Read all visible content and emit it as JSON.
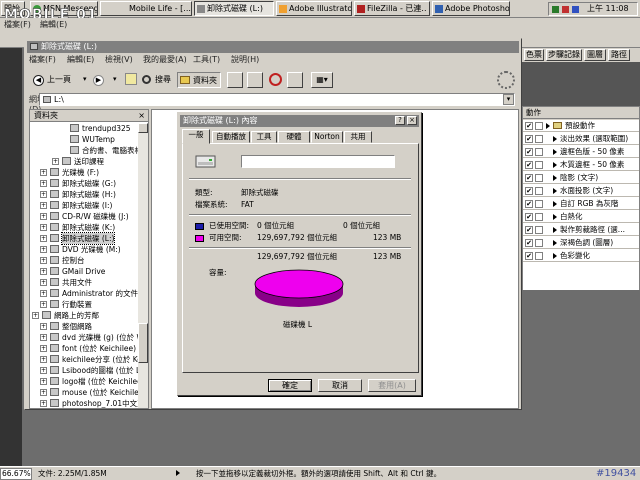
{
  "taskbar": {
    "start_label": "開始",
    "tasks": [
      {
        "label": "MSN Messenger (...",
        "active": false
      },
      {
        "label": "Mobile Life - [...",
        "active": false
      },
      {
        "label": "卸除式磁碟 (L:)",
        "active": true
      },
      {
        "label": "Adobe Illustrator -...",
        "active": false
      },
      {
        "label": "FileZilla - 已連..",
        "active": false
      },
      {
        "label": "Adobe Photoshop",
        "active": false
      }
    ],
    "clock": "上午 11:08"
  },
  "logo_text": "MOBILE 01",
  "ps_menu": [
    "檔案(F)",
    "編輯(E)"
  ],
  "explorer": {
    "title": "卸除式磁碟 (L:)",
    "menu": [
      "檔案(F)",
      "編輯(E)",
      "檢視(V)",
      "我的最愛(A)",
      "工具(T)",
      "說明(H)"
    ],
    "toolbar": {
      "back": "上一頁",
      "search": "搜尋",
      "folders": "資料夾"
    },
    "address_label": "網址(D)",
    "address_value": "L:\\",
    "folders_header": "資料夾",
    "tree": [
      {
        "label": "trendupd325",
        "indent": 30,
        "plus": false
      },
      {
        "label": "WUTemp",
        "indent": 30,
        "plus": false
      },
      {
        "label": "合約書、電腦表格",
        "indent": 30,
        "plus": false
      },
      {
        "label": "送印課程",
        "indent": 22,
        "plus": true
      },
      {
        "label": "光碟機 (F:)",
        "indent": 10,
        "plus": true
      },
      {
        "label": "卸除式磁碟 (G:)",
        "indent": 10,
        "plus": true
      },
      {
        "label": "卸除式磁碟 (H:)",
        "indent": 10,
        "plus": true
      },
      {
        "label": "卸除式磁碟 (I:)",
        "indent": 10,
        "plus": true
      },
      {
        "label": "CD-R/W 磁碟機 (J:)",
        "indent": 10,
        "plus": true
      },
      {
        "label": "卸除式磁碟 (K:)",
        "indent": 10,
        "plus": true
      },
      {
        "label": "卸除式磁碟 (L:)",
        "indent": 10,
        "plus": true,
        "selected": true
      },
      {
        "label": "DVD 光碟機 (M:)",
        "indent": 10,
        "plus": true
      },
      {
        "label": "控制台",
        "indent": 10,
        "plus": true
      },
      {
        "label": "GMail Drive",
        "indent": 10,
        "plus": true
      },
      {
        "label": "共用文件",
        "indent": 10,
        "plus": true
      },
      {
        "label": "Administrator 的文件",
        "indent": 10,
        "plus": true
      },
      {
        "label": "行動裝置",
        "indent": 10,
        "plus": true
      },
      {
        "label": "網路上的芳鄰",
        "indent": 2,
        "plus": true
      },
      {
        "label": "整個網路",
        "indent": 10,
        "plus": true
      },
      {
        "label": "dvd 光碟機 (g) (位於 W",
        "indent": 10,
        "plus": true
      },
      {
        "label": "font (位於 Keichilee)",
        "indent": 10,
        "plus": true
      },
      {
        "label": "keichilee分享 (位於 Kei",
        "indent": 10,
        "plus": true
      },
      {
        "label": "Lsibood的圖檔 (位於 L:",
        "indent": 10,
        "plus": true
      },
      {
        "label": "logo檔 (位於 Keichilee)",
        "indent": 10,
        "plus": true
      },
      {
        "label": "mouse (位於 Keichilee)",
        "indent": 10,
        "plus": true
      },
      {
        "label": "photoshop_7.01中文正式",
        "indent": 10,
        "plus": true
      }
    ]
  },
  "dialog": {
    "title": "卸除式磁碟 (L:) 內容",
    "help": "?",
    "close": "×",
    "tabs": [
      "一般",
      "自動播放",
      "工具",
      "硬體",
      "Norton",
      "共用"
    ],
    "type_label": "類型:",
    "type_value": "卸除式磁碟",
    "fs_label": "檔案系統:",
    "fs_value": "FAT",
    "used_label": "已使用空間:",
    "used_bytes": "0 個位元組",
    "used_size": "0 個位元組",
    "free_label": "可用空間:",
    "free_bytes": "129,697,792 個位元組",
    "free_size": "123 MB",
    "capacity_label": "容量:",
    "capacity_bytes": "129,697,792 個位元組",
    "capacity_size": "123 MB",
    "drive_caption": "磁碟機 L",
    "ok": "確定",
    "cancel": "取消",
    "apply": "套用(A)",
    "colors": {
      "used": "#1c1caa",
      "free": "#ee00ee"
    }
  },
  "right_panel": {
    "tabs": [
      "色票",
      "步驟記錄",
      "圖層",
      "路徑"
    ],
    "actions_title": "動作",
    "actions": [
      {
        "label": "預設動作",
        "checked": true,
        "level": 0
      },
      {
        "label": "淡出效果 (選取範圍)",
        "checked": true,
        "level": 1
      },
      {
        "label": "邊框色版 - 50 像素",
        "checked": true,
        "level": 1
      },
      {
        "label": "木質邊框 - 50 像素",
        "checked": true,
        "level": 1
      },
      {
        "label": "陰影 (文字)",
        "checked": true,
        "level": 1
      },
      {
        "label": "水面投影 (文字)",
        "checked": true,
        "level": 1
      },
      {
        "label": "自訂 RGB 為灰階",
        "checked": true,
        "level": 1
      },
      {
        "label": "白熱化",
        "checked": true,
        "level": 1
      },
      {
        "label": "製作剪裁路徑 (選...",
        "checked": true,
        "level": 1
      },
      {
        "label": "深褐色調 (圖層)",
        "checked": true,
        "level": 1
      },
      {
        "label": "色彩變化",
        "checked": true,
        "level": 1
      }
    ]
  },
  "status": {
    "zoom": "66.67%",
    "doc": "文件: 2.25M/1.85M",
    "hint": "按一下並拖移以定義裁切外框。額外的選項請使用 Shift、Alt 和 Ctrl 鍵。",
    "watermark": "#19434"
  }
}
